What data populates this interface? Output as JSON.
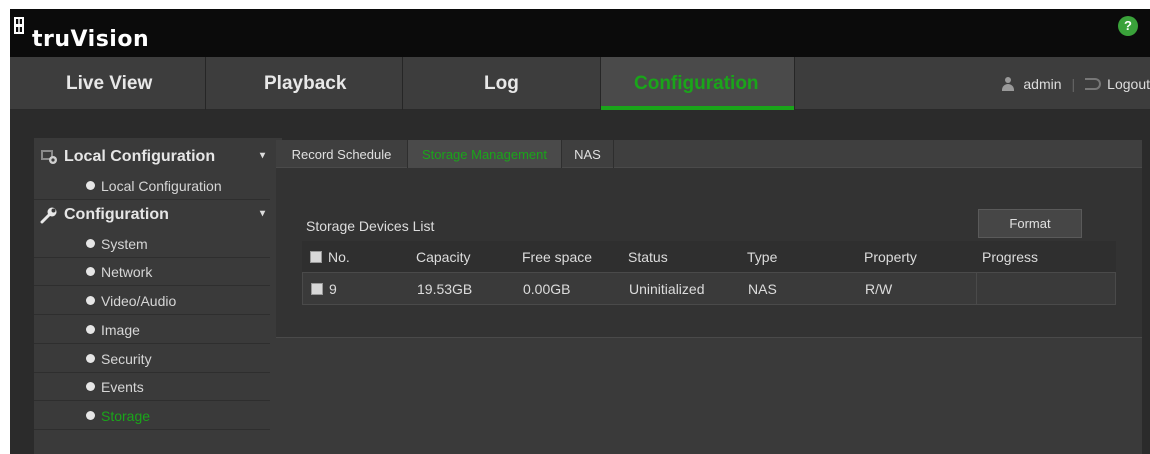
{
  "brand": {
    "name": "truVision"
  },
  "help": {
    "glyph": "?"
  },
  "nav": {
    "tabs": [
      {
        "label": "Live View"
      },
      {
        "label": "Playback"
      },
      {
        "label": "Log"
      },
      {
        "label": "Configuration",
        "active": true
      }
    ],
    "user": "admin",
    "separator": "|",
    "logout": "Logout"
  },
  "sidebar": {
    "sections": [
      {
        "label": "Local Configuration",
        "icon": "local-config-icon",
        "items": [
          {
            "label": "Local Configuration"
          }
        ]
      },
      {
        "label": "Configuration",
        "icon": "wrench-icon",
        "items": [
          {
            "label": "System"
          },
          {
            "label": "Network"
          },
          {
            "label": "Video/Audio"
          },
          {
            "label": "Image"
          },
          {
            "label": "Security"
          },
          {
            "label": "Events"
          },
          {
            "label": "Storage",
            "active": true
          }
        ]
      }
    ],
    "chevron_glyph": "▾"
  },
  "subtabs": [
    {
      "label": "Record Schedule"
    },
    {
      "label": "Storage Management",
      "active": true
    },
    {
      "label": "NAS"
    }
  ],
  "storage": {
    "list_title": "Storage Devices List",
    "format_label": "Format",
    "columns": [
      "No.",
      "Capacity",
      "Free space",
      "Status",
      "Type",
      "Property",
      "Progress"
    ],
    "rows": [
      {
        "no": "9",
        "capacity": "19.53GB",
        "free": "0.00GB",
        "status": "Uninitialized",
        "type": "NAS",
        "property": "R/W",
        "progress": ""
      }
    ]
  },
  "colors": {
    "accent": "#1aa51a",
    "help": "#3aa23a"
  }
}
